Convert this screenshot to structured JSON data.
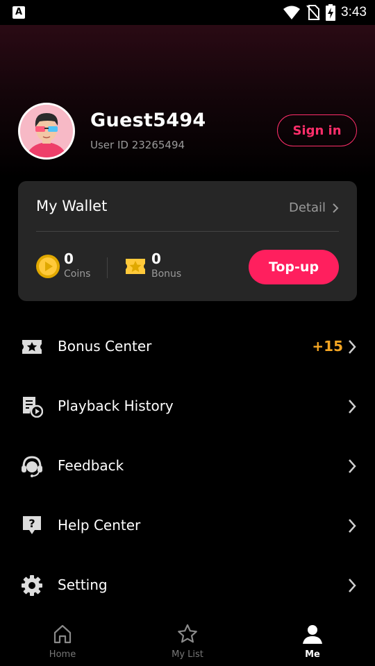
{
  "status_bar": {
    "time": "3:43",
    "icons": [
      "a-notification-icon",
      "wifi-icon",
      "no-sim-icon",
      "battery-charging-icon"
    ]
  },
  "profile": {
    "username": "Guest5494",
    "user_id": "User ID 23265494",
    "sign_in_label": "Sign in"
  },
  "wallet": {
    "title": "My Wallet",
    "detail_label": "Detail",
    "coins_value": "0",
    "coins_label": "Coins",
    "bonus_value": "0",
    "bonus_label": "Bonus",
    "topup_label": "Top-up"
  },
  "menu": {
    "items": [
      {
        "label": "Bonus Center",
        "icon": "ticket-star-icon",
        "badge": "+15"
      },
      {
        "label": "Playback History",
        "icon": "history-play-icon"
      },
      {
        "label": "Feedback",
        "icon": "headset-icon"
      },
      {
        "label": "Help Center",
        "icon": "help-icon"
      },
      {
        "label": "Setting",
        "icon": "gear-icon"
      }
    ]
  },
  "bottom_nav": {
    "items": [
      {
        "label": "Home",
        "icon": "home-icon"
      },
      {
        "label": "My List",
        "icon": "star-outline-icon"
      },
      {
        "label": "Me",
        "icon": "person-icon",
        "active": true
      }
    ]
  },
  "colors": {
    "accent": "#ff1f5e",
    "badge": "#f5a623",
    "card": "#262626",
    "background": "#000000"
  }
}
